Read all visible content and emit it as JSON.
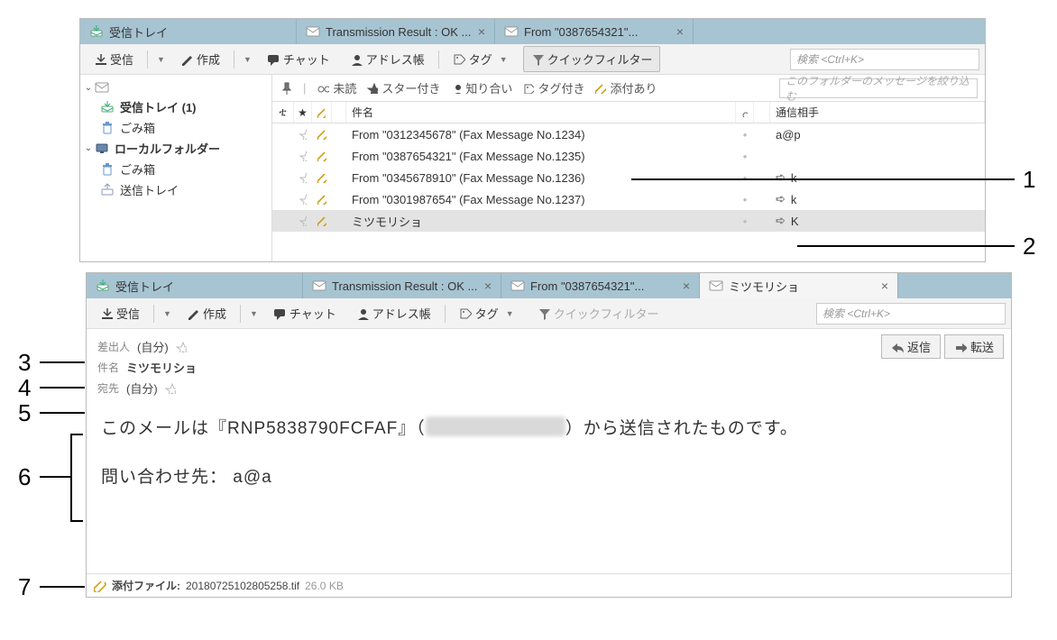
{
  "win1": {
    "tabs": [
      {
        "label": "受信トレイ",
        "type": "inbox"
      },
      {
        "label": "Transmission Result : OK ...",
        "type": "msg"
      },
      {
        "label": "From \"0387654321\"...",
        "type": "msg"
      }
    ],
    "toolbar": {
      "receive": "受信",
      "compose": "作成",
      "chat": "チャット",
      "addressbook": "アドレス帳",
      "tag": "タグ",
      "quickfilter": "クイックフィルター",
      "search_placeholder": "検索 <Ctrl+K>"
    },
    "folders": {
      "account_local": "ローカルフォルダー",
      "inbox": "受信トレイ (1)",
      "trash": "ごみ箱",
      "outbox": "送信トレイ"
    },
    "filterbar": {
      "unread": "未読",
      "starred": "スター付き",
      "contact": "知り合い",
      "tagged": "タグ付き",
      "attachment": "添付あり",
      "filter_placeholder": "このフォルダーのメッセージを絞り込む"
    },
    "columns": {
      "subject": "件名",
      "correspondent": "通信相手"
    },
    "rows": [
      {
        "subject": "From \"0312345678\" (Fax Message No.1234)",
        "corr": "a@p",
        "dir": ""
      },
      {
        "subject": "From \"0387654321\" (Fax Message No.1235)",
        "corr": "",
        "dir": ""
      },
      {
        "subject": "From \"0345678910\" (Fax Message No.1236)",
        "corr": "k",
        "dir": "out"
      },
      {
        "subject": "From \"0301987654\" (Fax Message No.1237)",
        "corr": "k",
        "dir": "out"
      },
      {
        "subject": "ミツモリショ",
        "corr": "K",
        "dir": "out",
        "selected": true
      }
    ]
  },
  "win2": {
    "tabs": [
      {
        "label": "受信トレイ",
        "type": "inbox"
      },
      {
        "label": "Transmission Result : OK ...",
        "type": "msg"
      },
      {
        "label": "From \"0387654321\"...",
        "type": "msg"
      },
      {
        "label": "ミツモリショ",
        "type": "msg",
        "active": true
      }
    ],
    "toolbar": {
      "receive": "受信",
      "compose": "作成",
      "chat": "チャット",
      "addressbook": "アドレス帳",
      "tag": "タグ",
      "quickfilter": "クイックフィルター",
      "search_placeholder": "検索 <Ctrl+K>"
    },
    "actions": {
      "reply": "返信",
      "forward": "転送"
    },
    "header": {
      "from_label": "差出人",
      "from_value": "(自分)",
      "subject_label": "件名",
      "subject_value": "ミツモリショ",
      "to_label": "宛先",
      "to_value": "(自分)"
    },
    "body": {
      "line1_a": "このメールは『RNP5838790FCFAF』（",
      "line1_b": "）から送信されたものです。",
      "line2": "問い合わせ先： a@a"
    },
    "attachment": {
      "label": "添付ファイル:",
      "name": "20180725102805258.tif",
      "size": "26.0 KB"
    }
  },
  "callouts": {
    "1": "1",
    "2": "2",
    "3": "3",
    "4": "4",
    "5": "5",
    "6": "6",
    "7": "7"
  }
}
